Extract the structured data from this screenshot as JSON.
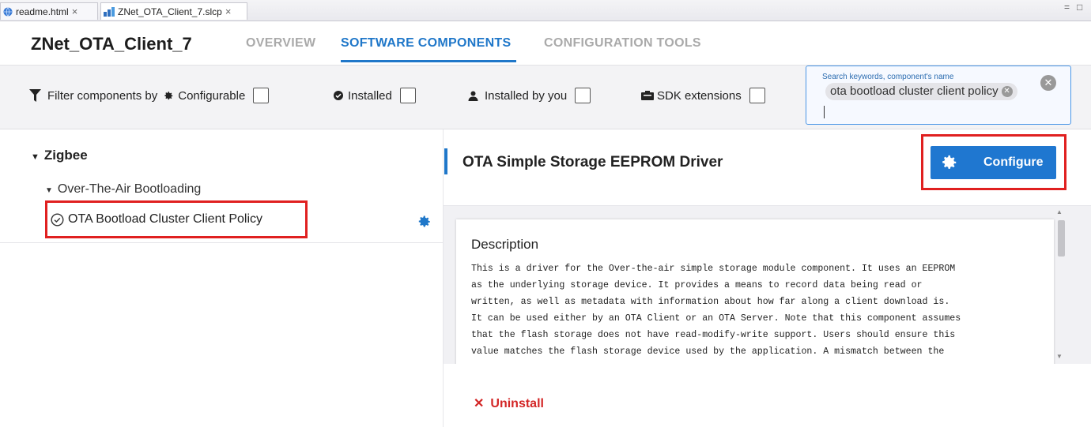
{
  "tabs": [
    {
      "label": "readme.html",
      "icon": "globe-icon"
    },
    {
      "label": "ZNet_OTA_Client_7.slcp",
      "icon": "project-icon"
    }
  ],
  "tab_close": "×",
  "window_controls": {
    "minimize": "=",
    "maximize": "□"
  },
  "header": {
    "title": "ZNet_OTA_Client_7",
    "nav": [
      "OVERVIEW",
      "SOFTWARE COMPONENTS",
      "CONFIGURATION TOOLS"
    ],
    "active_nav": "SOFTWARE COMPONENTS"
  },
  "filters": {
    "label": "Filter components by",
    "configurable": "Configurable",
    "installed": "Installed",
    "installed_by_you": "Installed by you",
    "sdk_extensions": "SDK extensions"
  },
  "search": {
    "placeholder": "Search keywords, component's name",
    "chip": "ota bootload cluster client policy"
  },
  "tree": {
    "category": "Zigbee",
    "subcategory": "Over-The-Air Bootloading",
    "component": "OTA Bootload Cluster Client Policy"
  },
  "detail": {
    "title": "OTA Simple Storage EEPROM Driver",
    "configure_label": "Configure",
    "description_heading": "Description",
    "description_lines": [
      "This is a driver for the Over-the-air simple storage module component. It uses an EEPROM",
      "as the underlying storage device. It provides a means to record data being read or",
      "written, as well as metadata with information about how far along a client download is.",
      "It can be used either by an OTA Client or an OTA Server. Note that this component assumes",
      "that the flash storage does not have read-modify-write support. Users should ensure this",
      "value matches the flash storage device used by the application. A mismatch between the"
    ],
    "uninstall_label": "Uninstall"
  },
  "colors": {
    "accent": "#1f77c9",
    "highlight": "#e02020",
    "uninstall": "#d32626"
  }
}
